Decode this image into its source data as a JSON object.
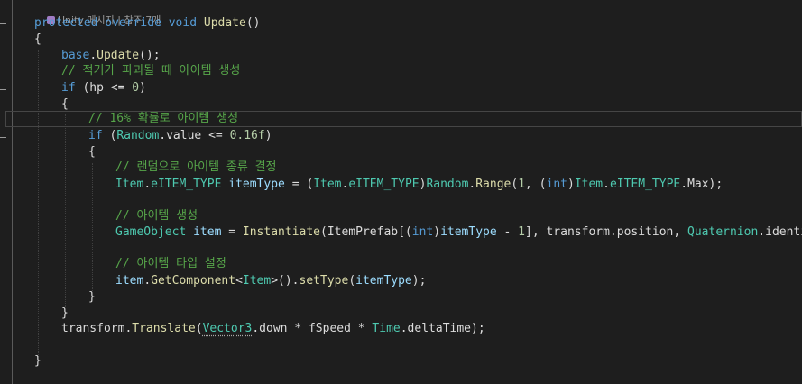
{
  "codelens": {
    "label": "Unity 메시지 | 참조 7개"
  },
  "lines": [
    {
      "id": "l1",
      "tokens": [
        [
          "kw",
          "protected"
        ],
        [
          "plain",
          " "
        ],
        [
          "kw",
          "override"
        ],
        [
          "plain",
          " "
        ],
        [
          "kw",
          "void"
        ],
        [
          "plain",
          " "
        ],
        [
          "method",
          "Update"
        ],
        [
          "plain",
          "()"
        ]
      ]
    },
    {
      "id": "l2",
      "tokens": [
        [
          "plain",
          "{"
        ]
      ]
    },
    {
      "id": "l3",
      "tokens": [
        [
          "kw",
          "base"
        ],
        [
          "plain",
          "."
        ],
        [
          "method",
          "Update"
        ],
        [
          "plain",
          "();"
        ]
      ]
    },
    {
      "id": "l4",
      "tokens": [
        [
          "cmt",
          "// 적기가 파괴될 때 아이템 생성"
        ]
      ]
    },
    {
      "id": "l5",
      "tokens": [
        [
          "kw",
          "if"
        ],
        [
          "plain",
          " (hp <= "
        ],
        [
          "num",
          "0"
        ],
        [
          "plain",
          ")"
        ]
      ]
    },
    {
      "id": "l6",
      "tokens": [
        [
          "plain",
          "{"
        ]
      ]
    },
    {
      "id": "l7",
      "tokens": [
        [
          "cmt",
          "// 16% 확률로 아이템 생성"
        ]
      ]
    },
    {
      "id": "l8",
      "tokens": [
        [
          "kw",
          "if"
        ],
        [
          "plain",
          " ("
        ],
        [
          "type",
          "Random"
        ],
        [
          "plain",
          ".value <= "
        ],
        [
          "num",
          "0.16f"
        ],
        [
          "plain",
          ")"
        ]
      ]
    },
    {
      "id": "l9",
      "tokens": [
        [
          "plain",
          "{"
        ]
      ]
    },
    {
      "id": "l10",
      "tokens": [
        [
          "cmt",
          "// 랜덤으로 아이템 종류 결정"
        ]
      ]
    },
    {
      "id": "l11",
      "tokens": [
        [
          "type",
          "Item"
        ],
        [
          "plain",
          "."
        ],
        [
          "type",
          "eITEM_TYPE"
        ],
        [
          "plain",
          " "
        ],
        [
          "local",
          "itemType"
        ],
        [
          "plain",
          " = ("
        ],
        [
          "type",
          "Item"
        ],
        [
          "plain",
          "."
        ],
        [
          "type",
          "eITEM_TYPE"
        ],
        [
          "plain",
          ")"
        ],
        [
          "type",
          "Random"
        ],
        [
          "plain",
          "."
        ],
        [
          "method",
          "Range"
        ],
        [
          "plain",
          "("
        ],
        [
          "num",
          "1"
        ],
        [
          "plain",
          ", ("
        ],
        [
          "kw",
          "int"
        ],
        [
          "plain",
          ")"
        ],
        [
          "type",
          "Item"
        ],
        [
          "plain",
          "."
        ],
        [
          "type",
          "eITEM_TYPE"
        ],
        [
          "plain",
          ".Max);"
        ]
      ]
    },
    {
      "id": "l12",
      "tokens": []
    },
    {
      "id": "l13",
      "tokens": [
        [
          "cmt",
          "// 아이템 생성"
        ]
      ]
    },
    {
      "id": "l14",
      "tokens": [
        [
          "type",
          "GameObject"
        ],
        [
          "plain",
          " "
        ],
        [
          "local",
          "item"
        ],
        [
          "plain",
          " = "
        ],
        [
          "method",
          "Instantiate"
        ],
        [
          "plain",
          "(ItemPrefab[("
        ],
        [
          "kw",
          "int"
        ],
        [
          "plain",
          ")"
        ],
        [
          "local",
          "itemType"
        ],
        [
          "plain",
          " - "
        ],
        [
          "num",
          "1"
        ],
        [
          "plain",
          "], transform.position, "
        ],
        [
          "type",
          "Quaternion"
        ],
        [
          "plain",
          ".identity);"
        ]
      ]
    },
    {
      "id": "l15",
      "tokens": []
    },
    {
      "id": "l16",
      "tokens": [
        [
          "cmt",
          "// 아이템 타입 설정"
        ]
      ]
    },
    {
      "id": "l17",
      "tokens": [
        [
          "local",
          "item"
        ],
        [
          "plain",
          "."
        ],
        [
          "method",
          "GetComponent"
        ],
        [
          "plain",
          "<"
        ],
        [
          "type",
          "Item"
        ],
        [
          "plain",
          ">()."
        ],
        [
          "method",
          "setType"
        ],
        [
          "plain",
          "("
        ],
        [
          "local",
          "itemType"
        ],
        [
          "plain",
          ");"
        ]
      ]
    },
    {
      "id": "l18",
      "tokens": [
        [
          "plain",
          "}"
        ]
      ]
    },
    {
      "id": "l19",
      "tokens": [
        [
          "plain",
          "}"
        ]
      ]
    },
    {
      "id": "l20",
      "tokens": [
        [
          "plain",
          "transform."
        ],
        [
          "method",
          "Translate"
        ],
        [
          "plain",
          "("
        ],
        [
          "type",
          "Vector3"
        ],
        [
          "plain",
          ".down * fSpeed * "
        ],
        [
          "type",
          "Time"
        ],
        [
          "plain",
          ".deltaTime);"
        ]
      ]
    },
    {
      "id": "l21",
      "tokens": []
    },
    {
      "id": "l22",
      "tokens": [
        [
          "plain",
          "}"
        ]
      ]
    }
  ]
}
